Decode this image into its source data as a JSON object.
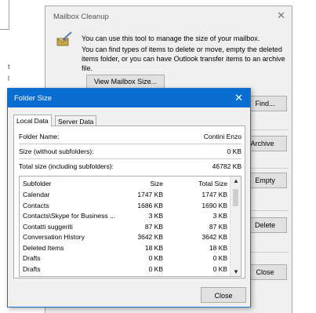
{
  "background": {
    "left_text_1": "t",
    "left_text_2": "l"
  },
  "mailbox_cleanup": {
    "title": "Mailbox Cleanup",
    "close_glyph": "✕",
    "icon": "mailbox-cleanup-icon",
    "desc1": "You can use this tool to manage the size of your mailbox.",
    "desc2": "You can find types of items to delete or move, empty the deleted items folder, or you can have Outlook transfer items to an archive file.",
    "view_button": "View Mailbox Size...",
    "find_button": "Find...",
    "autoarchive_button": "AutoArchive",
    "empty_button": "Empty",
    "delete_button": "Delete",
    "close_button": "Close"
  },
  "folder_size": {
    "title": "Folder Size",
    "close_glyph": "✕",
    "tabs": [
      "Local Data",
      "Server Data"
    ],
    "folder_name_label": "Folder Name:",
    "folder_name_value": "Contini Enzo",
    "size_label": "Size (without subfolders):",
    "size_value": "0 KB",
    "total_label": "Total size (including subfolders):",
    "total_value": "46782 KB",
    "table": {
      "headers": [
        "Subfolder",
        "Size",
        "Total Size"
      ],
      "rows": [
        [
          "Calendar",
          "1747 KB",
          "1747 KB"
        ],
        [
          "Contacts",
          "1686 KB",
          "1690 KB"
        ],
        [
          "Contacts\\Skype for Business ...",
          "3 KB",
          "3 KB"
        ],
        [
          "Contatti suggeriti",
          "87 KB",
          "87 KB"
        ],
        [
          "Conversation History",
          "3642 KB",
          "3642 KB"
        ],
        [
          "Deleted Items",
          "18 KB",
          "18 KB"
        ],
        [
          "Drafts",
          "0 KB",
          "0 KB"
        ],
        [
          "Drafts",
          "0 KB",
          "0 KB"
        ]
      ]
    },
    "close_button": "Close"
  },
  "colors": {
    "titlebar": "#0a6ed1",
    "dialog_bg": "#f0f0f0",
    "button_bg": "#e1e1e1"
  }
}
